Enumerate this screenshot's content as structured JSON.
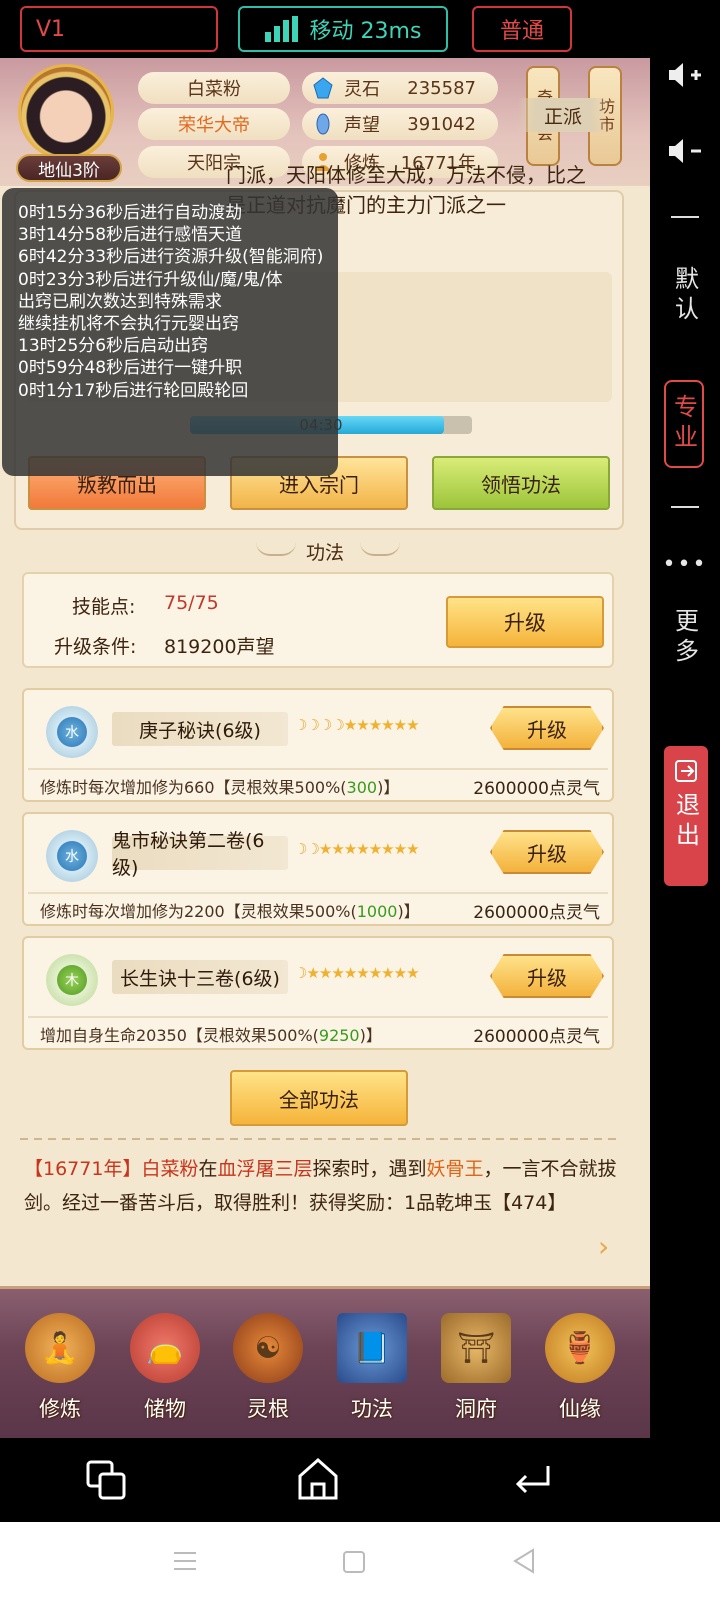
{
  "topbar": {
    "version": "V1",
    "network": "移动 23ms",
    "mode": "普通"
  },
  "side": {
    "vol_up_icon": "speaker-plus",
    "vol_down_icon": "speaker-minus",
    "default": "默认",
    "pro": "专业",
    "more": "更多",
    "exit": "退出"
  },
  "player": {
    "name": "白菜粉",
    "title": "荣华大帝",
    "sect": "天阳宗",
    "rank": "地仙3阶",
    "stats": [
      {
        "label": "灵石",
        "value": "235587",
        "icon": "crystal-icon"
      },
      {
        "label": "声望",
        "value": "391042",
        "icon": "reputation-icon"
      },
      {
        "label": "修炼",
        "value": "16771年",
        "icon": "meditation-icon"
      }
    ],
    "lanterns": [
      "奇珍会",
      "坊市"
    ]
  },
  "sect_panel": {
    "alignment": "正派",
    "description": "门派，天阳体修至大成，万法不侵，比之 是正道对抗魔门的主力门派之一",
    "desc_line1": "门派，天阳体修至大成，万法不侵，比之",
    "desc_line2": "是正道对抗魔门的主力门派之一",
    "timer": "04:30",
    "timer_progress": 0.9,
    "buttons": {
      "leave": "叛教而出",
      "enter": "进入宗门",
      "learn": "领悟功法"
    }
  },
  "overlay_log": [
    "0时15分36秒后进行自动渡劫",
    "3时14分58秒后进行感悟天道",
    "6时42分33秒后进行资源升级(智能洞府)",
    "0时23分3秒后进行升级仙/魔/鬼/体",
    "出窍已刷次数达到特殊需求",
    "继续挂机将不会执行元婴出窍",
    "13时25分6秒后启动出窍",
    "0时59分48秒后进行一键升职",
    "0时1分17秒后进行轮回殿轮回"
  ],
  "skills_section": {
    "title": "功法",
    "skill_points_label": "技能点:",
    "skill_points_value": "75/75",
    "upgrade_cond_label": "升级条件:",
    "upgrade_cond_value": "819200声望",
    "upgrade_label": "升级",
    "all_skills": "全部功法",
    "items": [
      {
        "element": "水",
        "name": "庚子秘诀(6级)",
        "moons": 4,
        "stars": 6,
        "desc_pre": "修炼时每次增加修为660【灵根效果500%(",
        "desc_num": "300",
        "desc_post": ")】",
        "cost": "2600000点灵气",
        "btn": "升级"
      },
      {
        "element": "水",
        "name": "鬼市秘诀第二卷(6级)",
        "moons": 2,
        "stars": 8,
        "desc_pre": "修炼时每次增加修为2200【灵根效果500%(",
        "desc_num": "1000",
        "desc_post": ")】",
        "cost": "2600000点灵气",
        "btn": "升级"
      },
      {
        "element": "木",
        "name": "长生诀十三卷(6级)",
        "moons": 1,
        "stars": 9,
        "desc_pre": "增加自身生命20350【灵根效果500%(",
        "desc_num": "9250",
        "desc_post": ")】",
        "cost": "2600000点灵气",
        "btn": "升级"
      }
    ]
  },
  "event_log": {
    "year": "【16771年】",
    "name": "白菜粉",
    "t1": "在",
    "place": "血浮屠三层",
    "t2": "探索时，遇到",
    "enemy": "妖骨王",
    "t3": "，一言不合就拔剑。经过一番苦斗后，取得胜利！获得奖励：1品乾坤玉【474】"
  },
  "bottom_nav": [
    "修炼",
    "储物",
    "灵根",
    "功法",
    "洞府",
    "仙缘"
  ],
  "colors": {
    "accent_red": "#e04a48",
    "teal": "#3ed4b8",
    "cream": "#f3e7cf"
  }
}
